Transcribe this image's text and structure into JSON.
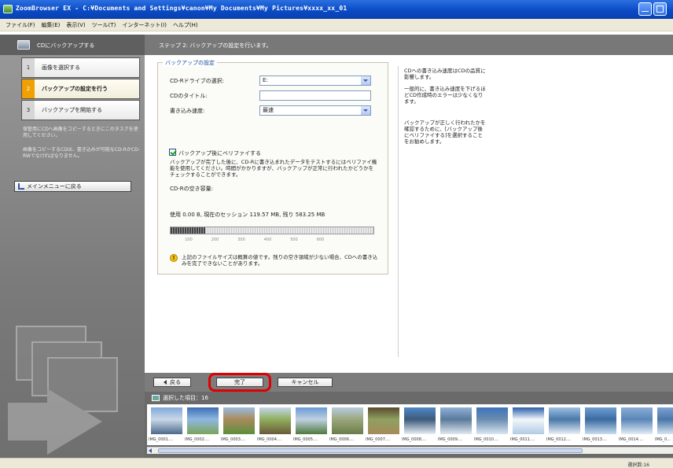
{
  "window": {
    "title": "ZoomBrowser EX  -  C:¥Documents and Settings¥canon¥My Documents¥My Pictures¥xxxx_xx_01"
  },
  "menubar": {
    "items": [
      {
        "label": "ファイル(F)"
      },
      {
        "label": "編集(E)"
      },
      {
        "label": "表示(V)"
      },
      {
        "label": "ツール(T)"
      },
      {
        "label": "インターネット(I)"
      },
      {
        "label": "ヘルプ(H)"
      }
    ]
  },
  "sidebar": {
    "header": "CDにバックアップする",
    "steps": [
      {
        "num": "1",
        "label": "画像を選択する",
        "active": false
      },
      {
        "num": "2",
        "label": "バックアップの設定を行う",
        "active": true
      },
      {
        "num": "3",
        "label": "バックアップを開始する",
        "active": false
      }
    ],
    "note1": "保管用にCDへ画像をコピーするときにこのタスクを使用してください。",
    "note2": "画像をコピーするCDは、書き込みが可能なCD-RかCD-RWでなければなりません。",
    "main_menu_button": "メインメニューに戻る"
  },
  "main": {
    "header": "ステップ 2: バックアップの設定を行います。",
    "group_title": "バックアップの設定",
    "form": {
      "drive_label": "CD-Rドライブの選択:",
      "drive_value": "E:",
      "cd_title_label": "CDのタイトル:",
      "cd_title_value": "",
      "speed_label": "書き込み速度:",
      "speed_value": "最速"
    },
    "verify_checkbox_label": "バックアップ後にベリファイする",
    "verify_checked": true,
    "verify_description": "バックアップが完了した後に、CD-Rに書き込まれたデータをテストするにはベリファイ機能を使用してください。時間がかかりますが、バックアップが正常に行われたかどうかをチェックすることができます。",
    "free_space_title": "CD-Rの空き容量:",
    "usage_text": "使用 0.00 B, 現在のセッション 119.57 MB, 残り 583.25 MB",
    "usage_fraction": 0.17,
    "ticks": [
      "100",
      "200",
      "300",
      "400",
      "500",
      "600"
    ],
    "warning_icon": "warning-icon",
    "warning_text": "上記のファイルサイズは概算の値です。残りの空き領域が少ない場合、CDへの書き込みを完了できないことがあります。",
    "side_notes": [
      "CDへの書き込み速度はCDの品質に影響します。",
      "一般的に、書き込み速度を下げるほどCD作成時のエラーは少なくなります。",
      "バックアップが正しく行われたかを確認するために、[バックアップ後にベリファイする]を選択することをお勧めします。"
    ]
  },
  "buttons": {
    "back": "戻る",
    "finish": "完了",
    "cancel": "キャンセル"
  },
  "strip": {
    "header": "選択した項目：16",
    "thumbnails": [
      {
        "caption": "IMG_0001....",
        "colors": [
          "#7fa8d8",
          "#4c6a8a",
          "#c9d8e8"
        ]
      },
      {
        "caption": "IMG_0002....",
        "colors": [
          "#3d6fb5",
          "#7aa55a",
          "#8fb7e0"
        ]
      },
      {
        "caption": "IMG_0003....",
        "colors": [
          "#9bbbe0",
          "#5c8f3c",
          "#a88a5a"
        ]
      },
      {
        "caption": "IMG_0004....",
        "colors": [
          "#c4d6ea",
          "#6a5a3a",
          "#8fae5c"
        ]
      },
      {
        "caption": "IMG_0005....",
        "colors": [
          "#6a9ad6",
          "#4f7a3d",
          "#c0d0e0"
        ]
      },
      {
        "caption": "IMG_0006....",
        "colors": [
          "#b8cce2",
          "#6a7d4a",
          "#9aa67a"
        ]
      },
      {
        "caption": "IMG_0007....",
        "colors": [
          "#5a4a30",
          "#a68a5a",
          "#8fa060"
        ]
      },
      {
        "caption": "IMG_0008....",
        "colors": [
          "#4f87c8",
          "#e6eef6",
          "#3d5a7a"
        ]
      },
      {
        "caption": "IMG_0009....",
        "colors": [
          "#8fb0d8",
          "#dfe8f0",
          "#5a7a9a"
        ]
      },
      {
        "caption": "IMG_0010....",
        "colors": [
          "#3e74bd",
          "#d8e6f2",
          "#6a8cb0"
        ]
      },
      {
        "caption": "IMG_0011....",
        "colors": [
          "#2a5ea8",
          "#b0cbe6",
          "#f2f6fa"
        ]
      },
      {
        "caption": "IMG_0012....",
        "colors": [
          "#9cc0e4",
          "#e8f0f8",
          "#4a78a8"
        ]
      },
      {
        "caption": "IMG_0013....",
        "colors": [
          "#6d9ed2",
          "#c8dcee",
          "#3a6aa0"
        ]
      },
      {
        "caption": "IMG_0014....",
        "colors": [
          "#88acd6",
          "#e2ecf6",
          "#5a86b8"
        ]
      },
      {
        "caption": "IMG_0...",
        "colors": [
          "#7aa2d2",
          "#d6e4f2",
          "#4a76a8"
        ]
      }
    ]
  },
  "status": {
    "text": "選択数:16"
  }
}
